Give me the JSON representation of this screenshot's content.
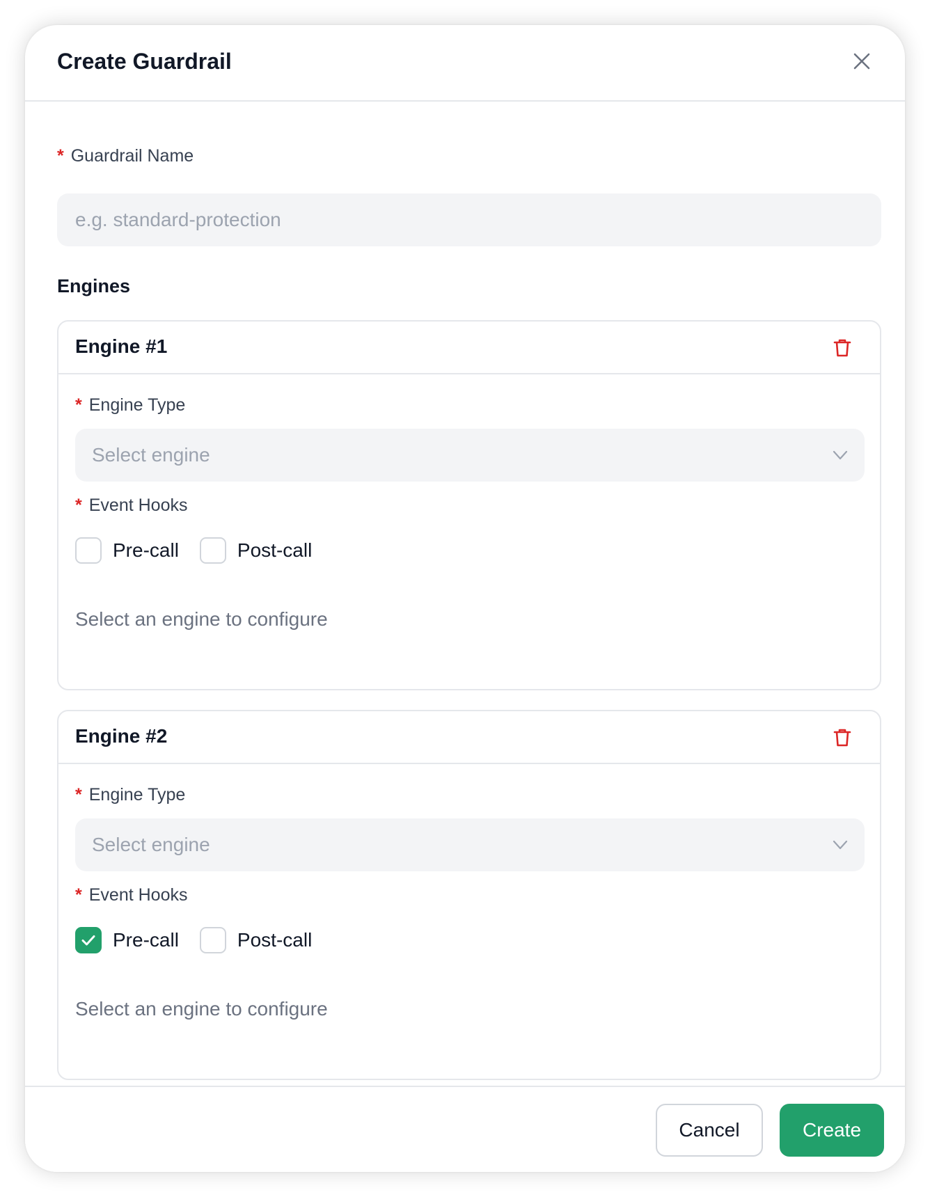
{
  "dialog": {
    "title": "Create Guardrail"
  },
  "guardrail_name": {
    "label": "Guardrail Name",
    "required_mark": "*",
    "placeholder": "e.g. standard-protection",
    "value": ""
  },
  "engines_section": {
    "title": "Engines",
    "engines": [
      {
        "title": "Engine #1",
        "engine_type_label": "Engine Type",
        "engine_type_placeholder": "Select engine",
        "event_hooks_label": "Event Hooks",
        "hooks": [
          {
            "label": "Pre-call",
            "checked": false
          },
          {
            "label": "Post-call",
            "checked": false
          }
        ],
        "hint": "Select an engine to configure"
      },
      {
        "title": "Engine #2",
        "engine_type_label": "Engine Type",
        "engine_type_placeholder": "Select engine",
        "event_hooks_label": "Event Hooks",
        "hooks": [
          {
            "label": "Pre-call",
            "checked": true
          },
          {
            "label": "Post-call",
            "checked": false
          }
        ],
        "hint": "Select an engine to configure"
      }
    ]
  },
  "footer": {
    "cancel_label": "Cancel",
    "create_label": "Create"
  },
  "colors": {
    "accent": "#22a06b",
    "required": "#dc2626",
    "delete_icon": "#dc2626"
  },
  "icons": {
    "close": "close-icon",
    "delete": "trash-icon",
    "dropdown": "chevron-down-icon",
    "check": "check-icon"
  }
}
